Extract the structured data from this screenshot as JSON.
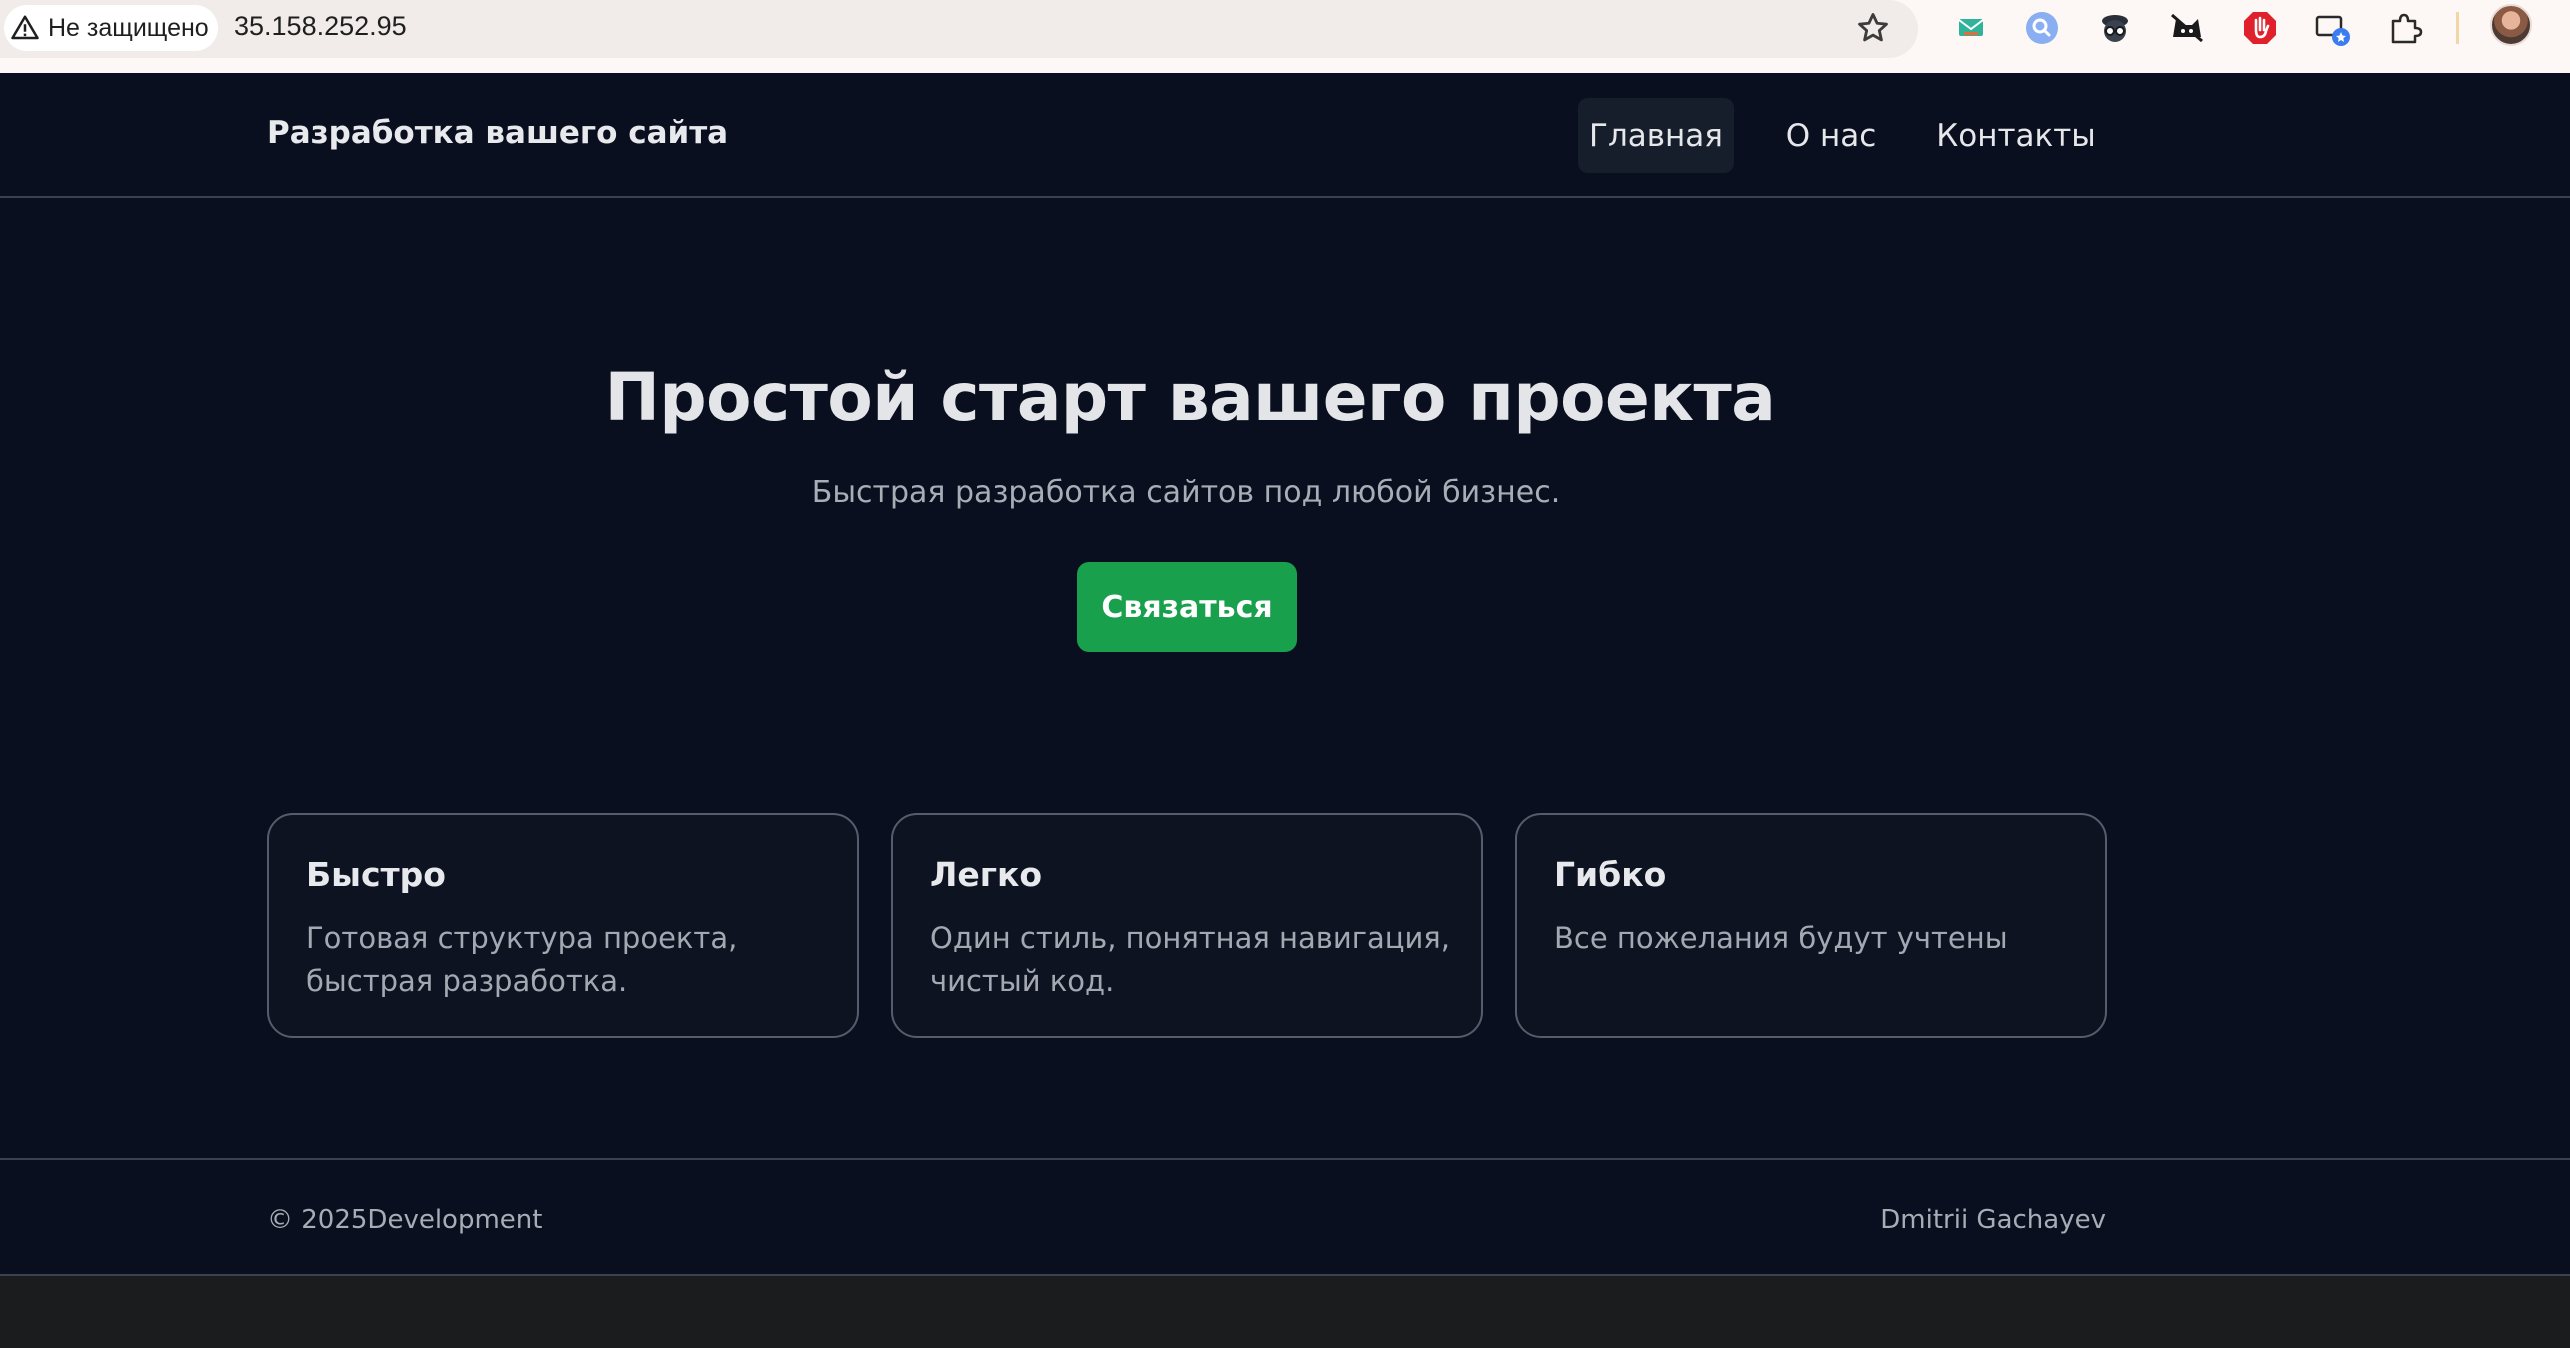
{
  "browser": {
    "security_label": "Не защищено",
    "url": "35.158.252.95",
    "extensions": [
      "mail-extension-icon",
      "search-extension-icon",
      "spy-extension-icon",
      "cat-extension-icon",
      "adblock-stop-icon",
      "screen-cast-icon",
      "extensions-puzzle-icon"
    ]
  },
  "header": {
    "brand": "Разработка вашего сайта",
    "nav": [
      {
        "label": "Главная",
        "active": true
      },
      {
        "label": "О нас",
        "active": false
      },
      {
        "label": "Контакты",
        "active": false
      }
    ]
  },
  "hero": {
    "title": "Простой старт вашего проекта",
    "subtitle": "Быстрая разработка сайтов под любой бизнес.",
    "cta_label": "Связаться"
  },
  "features": [
    {
      "title": "Быстро",
      "text": "Готовая структура проекта, быстрая разработка."
    },
    {
      "title": "Легко",
      "text": "Один стиль, понятная навигация, чистый код."
    },
    {
      "title": "Гибко",
      "text": "Все пожелания будут учтены"
    }
  ],
  "footer": {
    "left": "© 2025Development",
    "right": "Dmitrii Gachayev"
  },
  "colors": {
    "page_background": "#0a0f1f",
    "accent_green": "#18a04c",
    "text_primary": "#e8e9ec",
    "text_muted": "#a8acb5"
  }
}
